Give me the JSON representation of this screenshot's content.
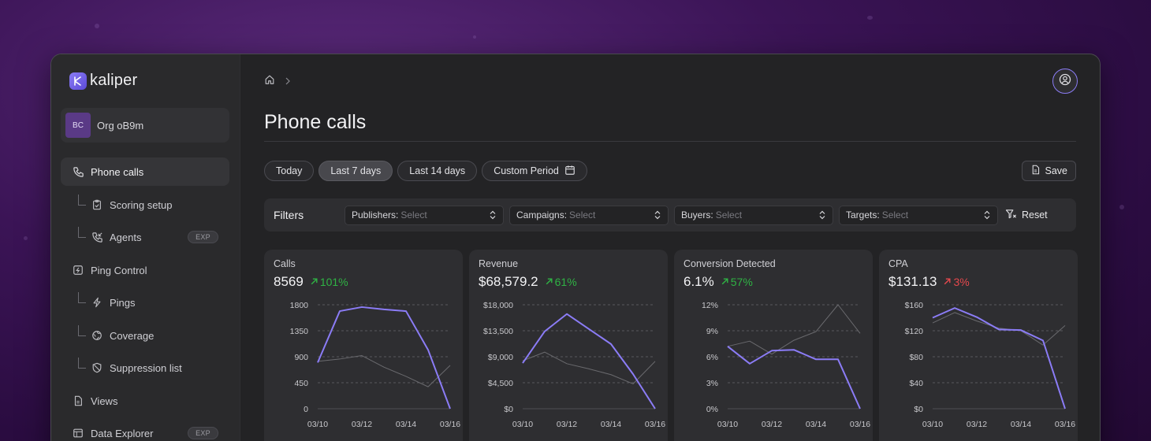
{
  "app": {
    "name": "kaliper",
    "org": {
      "initials": "BC",
      "name": "Org oB9m"
    }
  },
  "sidebar": {
    "items": [
      {
        "label": "Phone calls",
        "icon": "phone-icon",
        "active": true
      },
      {
        "label": "Scoring setup",
        "icon": "clipboard-check-icon"
      },
      {
        "label": "Agents",
        "icon": "phone-incoming-icon",
        "badge": "EXP"
      },
      {
        "label": "Ping Control",
        "icon": "square-bolt-icon"
      },
      {
        "label": "Pings",
        "icon": "bolt-icon"
      },
      {
        "label": "Coverage",
        "icon": "globe-icon"
      },
      {
        "label": "Suppression list",
        "icon": "shield-off-icon"
      },
      {
        "label": "Views",
        "icon": "document-icon"
      },
      {
        "label": "Data Explorer",
        "icon": "table-icon",
        "badge": "EXP"
      }
    ]
  },
  "header": {
    "title": "Phone calls"
  },
  "periods": {
    "options": [
      "Today",
      "Last 7 days",
      "Last 14 days",
      "Custom Period"
    ],
    "selected": "Last 7 days"
  },
  "actions": {
    "save_label": "Save",
    "reset_label": "Reset"
  },
  "filters": {
    "label": "Filters",
    "selects": [
      {
        "key": "Publishers:",
        "value": "Select"
      },
      {
        "key": "Campaigns:",
        "value": "Select"
      },
      {
        "key": "Buyers:",
        "value": "Select"
      },
      {
        "key": "Targets:",
        "value": "Select"
      }
    ]
  },
  "colors": {
    "accent": "#8b7cf6",
    "positive": "#2fb344",
    "negative": "#e5484d",
    "comparison_line": "#6a6a6e"
  },
  "cards": [
    {
      "title": "Calls",
      "value": "8569",
      "delta": "101%",
      "trend": "up"
    },
    {
      "title": "Revenue",
      "value": "$68,579.2",
      "delta": "61%",
      "trend": "up"
    },
    {
      "title": "Conversion Detected",
      "value": "6.1%",
      "delta": "57%",
      "trend": "up"
    },
    {
      "title": "CPA",
      "value": "$131.13",
      "delta": "3%",
      "trend": "down"
    }
  ],
  "chart_data": [
    {
      "type": "line",
      "title": "Calls",
      "x": [
        "03/10",
        "03/11",
        "03/12",
        "03/13",
        "03/14",
        "03/15",
        "03/16"
      ],
      "x_tick_labels": [
        "03/10",
        "03/12",
        "03/14",
        "03/16"
      ],
      "y_tick_labels": [
        "0",
        "450",
        "900",
        "1350",
        "1800"
      ],
      "ylim": [
        0,
        1800
      ],
      "grid": true,
      "series": [
        {
          "role": "current",
          "values": [
            800,
            1690,
            1760,
            1720,
            1690,
            1020,
            0
          ]
        },
        {
          "role": "previous",
          "values": [
            820,
            860,
            920,
            720,
            560,
            380,
            750
          ]
        }
      ]
    },
    {
      "type": "line",
      "title": "Revenue",
      "x": [
        "03/10",
        "03/11",
        "03/12",
        "03/13",
        "03/14",
        "03/15",
        "03/16"
      ],
      "x_tick_labels": [
        "03/10",
        "03/12",
        "03/14",
        "03/16"
      ],
      "y_tick_labels": [
        "$0",
        "$4,500",
        "$9,000",
        "$13,500",
        "$18,000"
      ],
      "ylim": [
        0,
        18000
      ],
      "grid": true,
      "series": [
        {
          "role": "current",
          "values": [
            7900,
            13400,
            16400,
            13800,
            11200,
            6000,
            0
          ]
        },
        {
          "role": "previous",
          "values": [
            8300,
            9800,
            7800,
            6900,
            5900,
            4300,
            8200
          ]
        }
      ]
    },
    {
      "type": "line",
      "title": "Conversion Detected",
      "x": [
        "03/10",
        "03/11",
        "03/12",
        "03/13",
        "03/14",
        "03/15",
        "03/16"
      ],
      "x_tick_labels": [
        "03/10",
        "03/12",
        "03/14",
        "03/16"
      ],
      "y_tick_labels": [
        "0%",
        "3%",
        "6%",
        "9%",
        "12%"
      ],
      "ylim": [
        0,
        12
      ],
      "grid": true,
      "series": [
        {
          "role": "current",
          "values": [
            7.2,
            5.2,
            6.7,
            6.8,
            5.7,
            5.7,
            0
          ]
        },
        {
          "role": "previous",
          "values": [
            7.2,
            7.8,
            6.3,
            7.9,
            8.9,
            12.0,
            8.7
          ]
        }
      ]
    },
    {
      "type": "line",
      "title": "CPA",
      "x": [
        "03/10",
        "03/11",
        "03/12",
        "03/13",
        "03/14",
        "03/15",
        "03/16"
      ],
      "x_tick_labels": [
        "03/10",
        "03/12",
        "03/14",
        "03/16"
      ],
      "y_tick_labels": [
        "$0",
        "$40",
        "$80",
        "$120",
        "$160"
      ],
      "ylim": [
        0,
        160
      ],
      "grid": true,
      "series": [
        {
          "role": "current",
          "values": [
            140,
            155,
            141,
            122,
            121,
            105,
            0
          ]
        },
        {
          "role": "previous",
          "values": [
            132,
            148,
            135,
            124,
            120,
            98,
            128
          ]
        }
      ]
    }
  ]
}
